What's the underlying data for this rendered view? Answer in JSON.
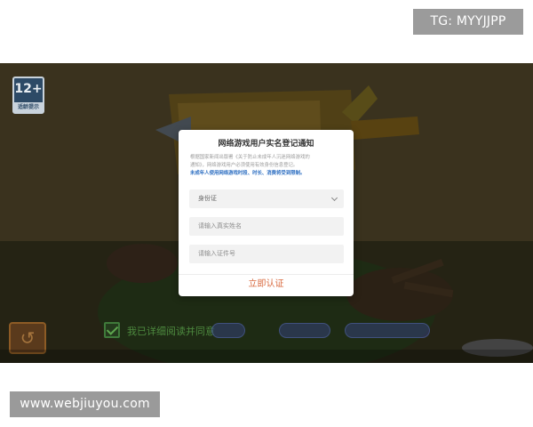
{
  "watermarks": {
    "telegram": "TG: MYYJJPP",
    "site": "www.webjiuyou.com"
  },
  "game": {
    "age_rating": {
      "label": "12+",
      "footer": "适龄提示"
    },
    "consent_text": "我已详细阅读并同意"
  },
  "dialog": {
    "title": "网络游戏用户实名登记通知",
    "description_line1": "根据国家新闻出版署《关于防止未成年人沉迷网络游戏的",
    "description_line2": "通知》，网络游戏用户必须使用有效身份信息登记。",
    "description_highlight": "未成年人使用网络游戏时段、时长、消费将受到限制。",
    "id_type": {
      "selected": "身份证"
    },
    "name_input": {
      "placeholder": "请输入真实姓名"
    },
    "id_input": {
      "placeholder": "请输入证件号"
    },
    "submit_label": "立即认证"
  },
  "colors": {
    "submit": "#d8693e",
    "highlight": "#2e6fc2",
    "watermark_bg": "#9b9b9b"
  }
}
